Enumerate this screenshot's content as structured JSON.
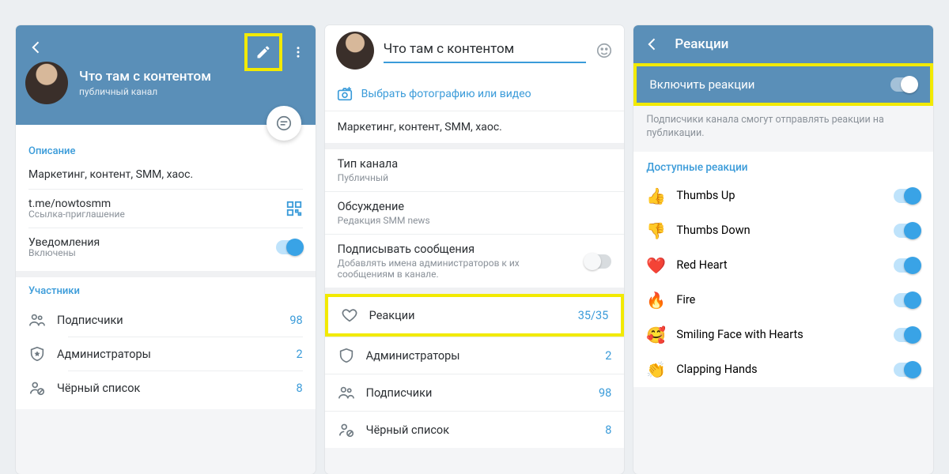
{
  "panel1": {
    "title": "Что там с контентом",
    "subtitle": "публичный канал",
    "section_about_title": "Описание",
    "description": "Маркетинг, контент, SMM, хаос.",
    "link": "t.me/nowtosmm",
    "link_sub": "Ссылка-приглашение",
    "notif_label": "Уведомления",
    "notif_value": "Включены",
    "members_title": "Участники",
    "rows": [
      {
        "label": "Подписчики",
        "value": "98"
      },
      {
        "label": "Администраторы",
        "value": "2"
      },
      {
        "label": "Чёрный список",
        "value": "8"
      }
    ]
  },
  "panel2": {
    "name": "Что там с контентом",
    "pick_media": "Выбрать фотографию или видео",
    "description": "Маркетинг, контент, SMM, хаос.",
    "type_label": "Тип канала",
    "type_value": "Публичный",
    "discussion_label": "Обсуждение",
    "discussion_value": "Редакция SMM news",
    "sign_label": "Подписывать сообщения",
    "sign_hint": "Добавлять имена администраторов к их сообщениям в канале.",
    "reactions_label": "Реакции",
    "reactions_value": "35/35",
    "rows": [
      {
        "label": "Администраторы",
        "value": "2"
      },
      {
        "label": "Подписчики",
        "value": "98"
      },
      {
        "label": "Чёрный список",
        "value": "8"
      }
    ]
  },
  "panel3": {
    "header": "Реакции",
    "enable_label": "Включить реакции",
    "hint": "Подписчики канала смогут отправлять реакции на публикации.",
    "list_title": "Доступные реакции",
    "reactions": [
      {
        "emoji": "👍",
        "label": "Thumbs Up"
      },
      {
        "emoji": "👎",
        "label": "Thumbs Down"
      },
      {
        "emoji": "❤️",
        "label": "Red Heart"
      },
      {
        "emoji": "🔥",
        "label": "Fire"
      },
      {
        "emoji": "🥰",
        "label": "Smiling Face with Hearts"
      },
      {
        "emoji": "👏",
        "label": "Clapping Hands"
      }
    ]
  }
}
